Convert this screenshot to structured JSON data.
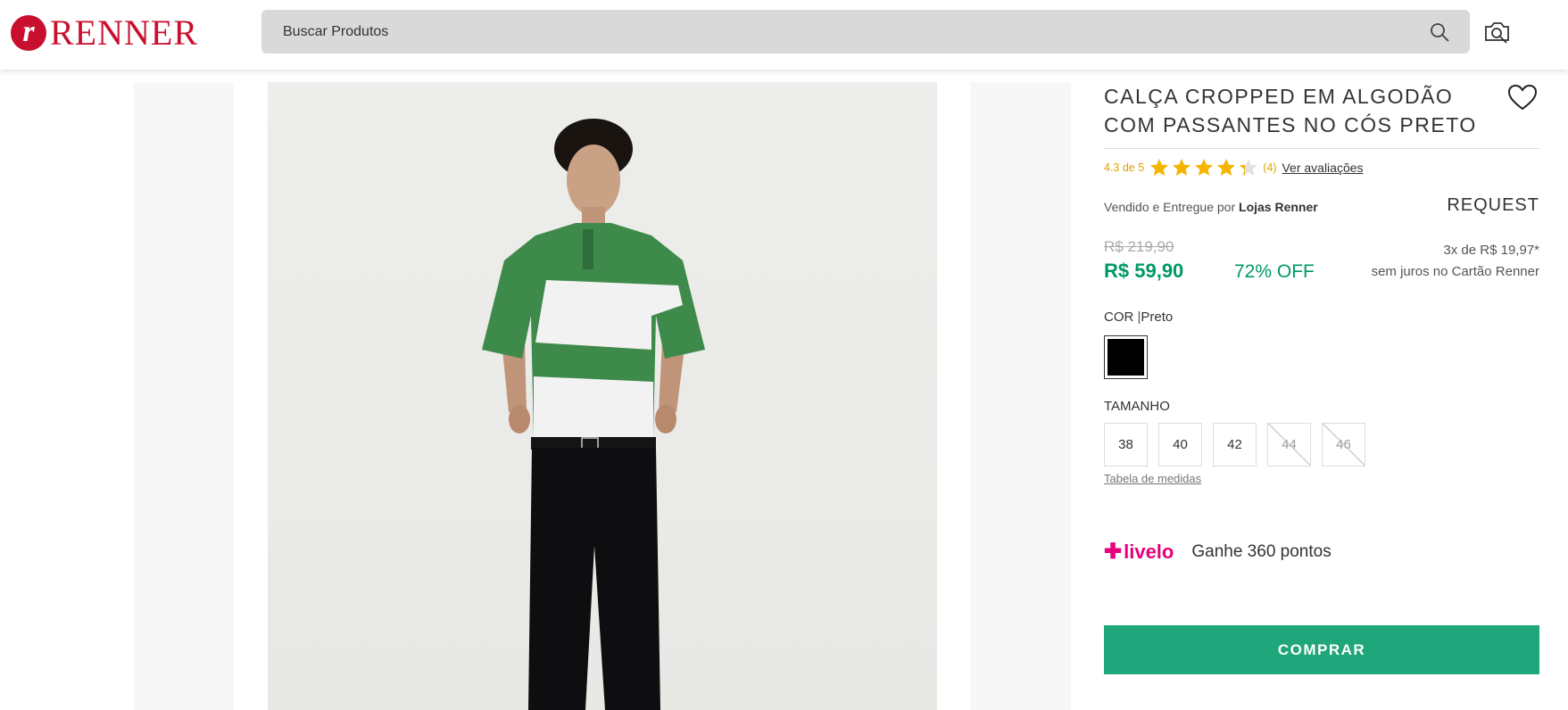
{
  "header": {
    "logo_text": "RENNER",
    "logo_mark": "r",
    "search_placeholder": "Buscar Produtos",
    "search_icon": "search-icon",
    "camera_icon": "camera-search-icon"
  },
  "product": {
    "title": "CALÇA CROPPED EM ALGODÃO COM PASSANTES NO CÓS PRETO",
    "rating": {
      "text": "4.3 de 5",
      "value": 4.3,
      "max": 5,
      "count": "(4)",
      "link": "Ver avaliações"
    },
    "seller_prefix": "Vendido e Entregue por",
    "seller_name": "Lojas Renner",
    "brand": "REQUEST",
    "old_price": "R$ 219,90",
    "price": "R$ 59,90",
    "discount": "72% OFF",
    "installments_line1": "3x de R$ 19,97*",
    "installments_line2": "sem juros no Cartão Renner",
    "color_label": "COR",
    "color_value": "Preto",
    "size_label": "TAMANHO",
    "sizes": [
      {
        "label": "38",
        "available": true
      },
      {
        "label": "40",
        "available": true
      },
      {
        "label": "42",
        "available": true
      },
      {
        "label": "44",
        "available": false
      },
      {
        "label": "46",
        "available": false
      }
    ],
    "size_table": "Tabela de medidas",
    "livelo_logo": "livelo",
    "livelo_points": "Ganhe 360 pontos",
    "buy_label": "COMPRAR"
  },
  "colors": {
    "brand_red": "#c8102e",
    "price_green": "#009966",
    "buy_green": "#1fa67a",
    "star_gold": "#f5b400",
    "livelo_pink": "#e6007e"
  }
}
